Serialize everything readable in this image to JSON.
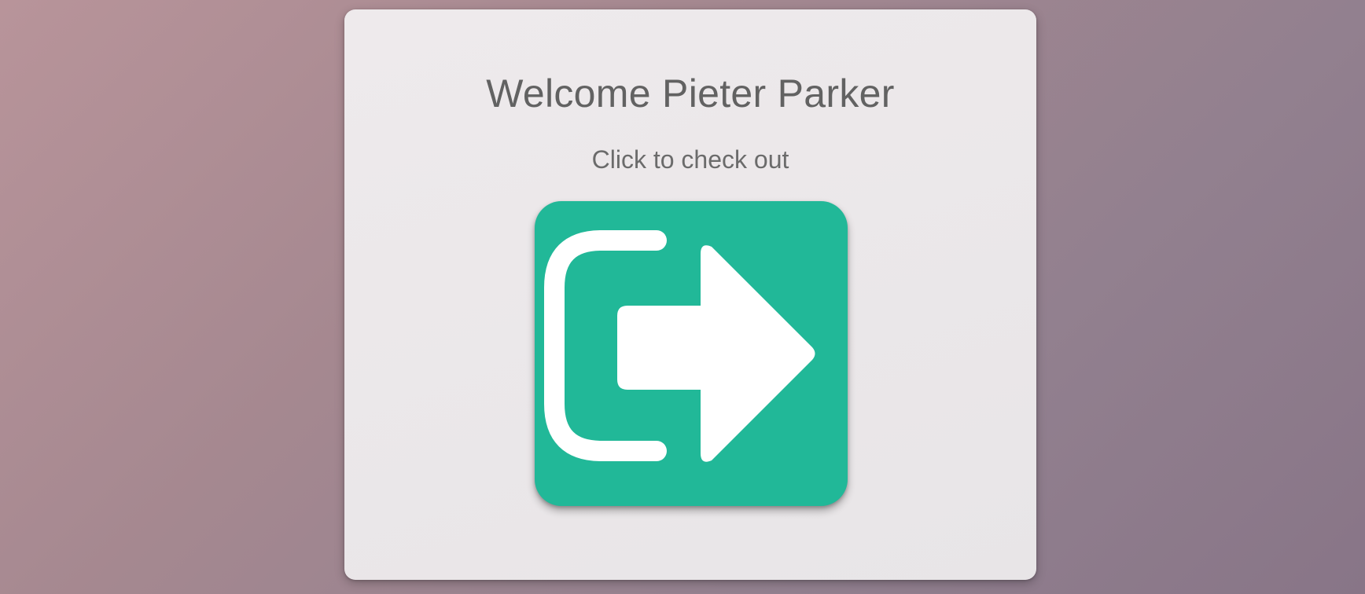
{
  "card": {
    "title": "Welcome Pieter Parker",
    "subtitle": "Click to check out"
  },
  "checkout_button": {
    "icon": "logout-arrow-icon",
    "color": "#21b898"
  },
  "colors": {
    "background_start": "#b8949a",
    "background_end": "#887587",
    "card": "#ebe7e9",
    "text": "#626262",
    "accent": "#21b898"
  }
}
